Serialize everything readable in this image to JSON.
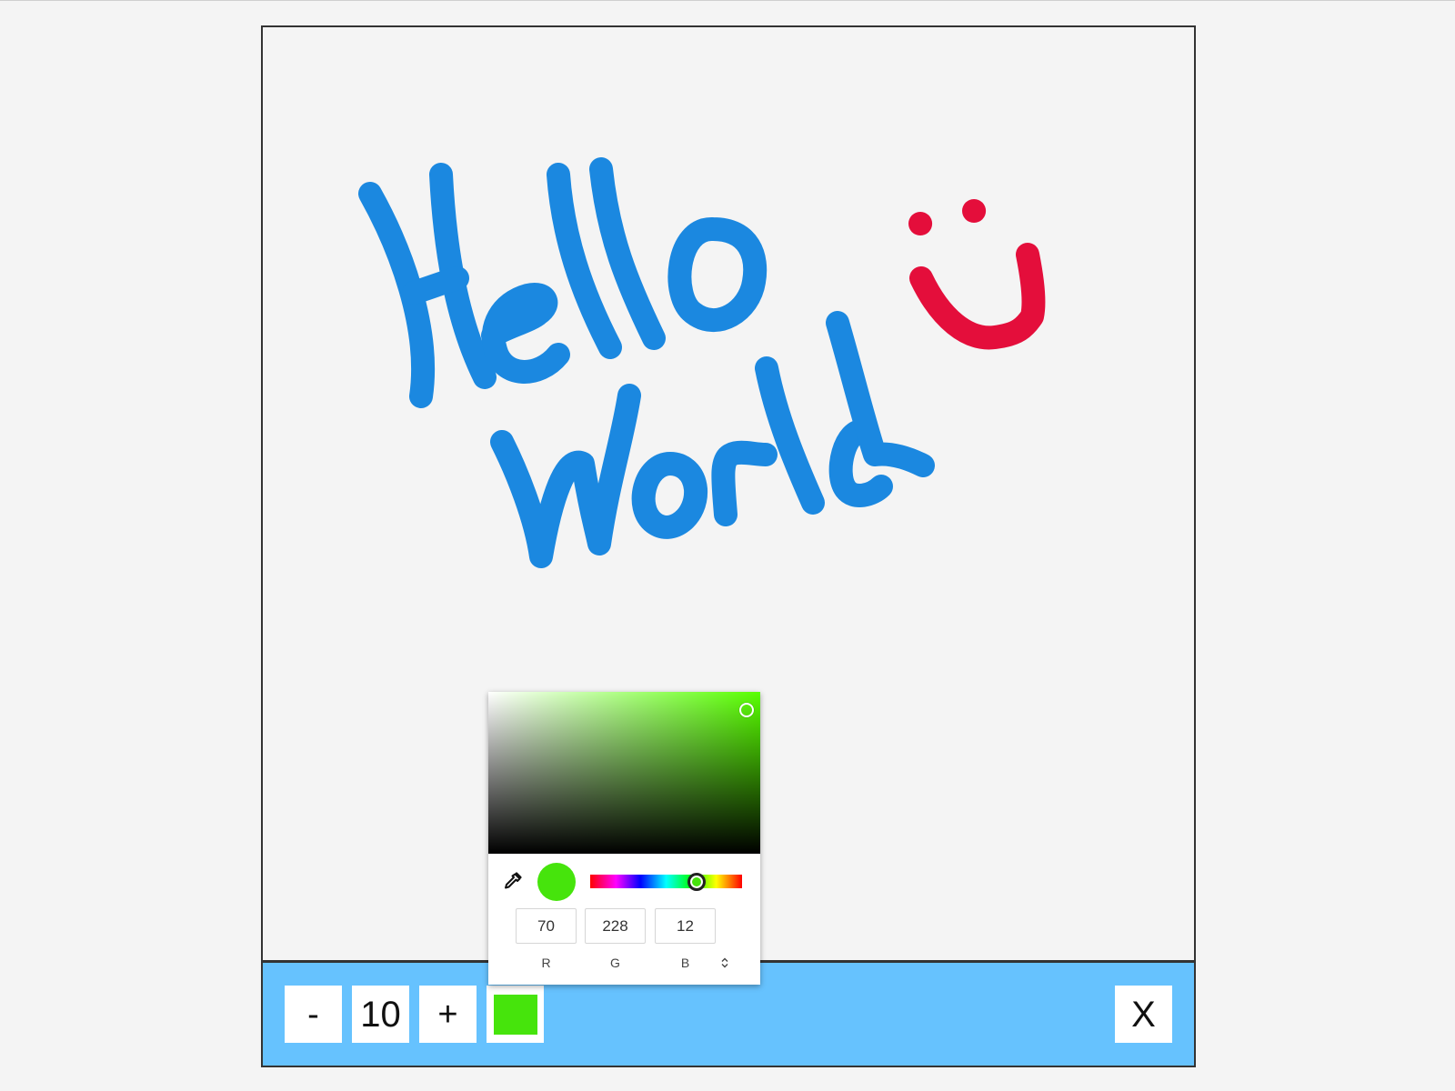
{
  "app": {
    "background_color": "#f4f4f4"
  },
  "canvas": {
    "drawings": [
      {
        "name": "hello-world-text",
        "color": "#1b88e0"
      },
      {
        "name": "smiley-face",
        "color": "#e40e3b"
      }
    ]
  },
  "toolbar": {
    "decrease_label": "-",
    "brush_size": "10",
    "increase_label": "+",
    "current_color": "#46e40c",
    "close_label": "X",
    "background_color": "#66c2fe"
  },
  "color_picker": {
    "hex": "#46e40c",
    "hue_color": "#58ff00",
    "hue_fraction": 0.7,
    "saturation_fraction": 0.95,
    "value_fraction": 0.89,
    "eyedropper_icon": "eyedropper-icon",
    "toggle_icon": "up-down-chevron-icon",
    "rgb": {
      "r": "70",
      "g": "228",
      "b": "12"
    },
    "labels": {
      "r": "R",
      "g": "G",
      "b": "B"
    }
  }
}
